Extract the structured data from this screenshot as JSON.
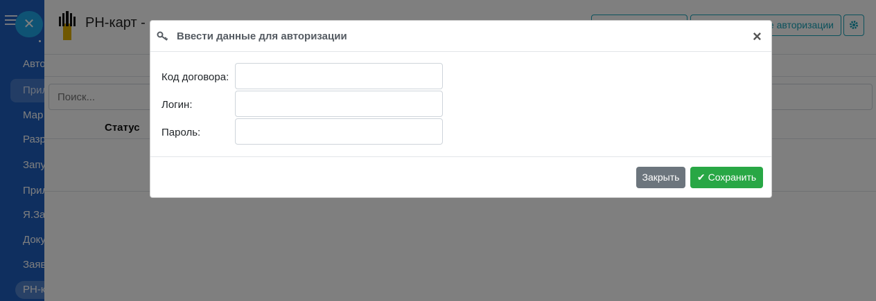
{
  "sidebar": {
    "close_icon": "✕",
    "items": [
      "Авто",
      "Прил",
      "Мар",
      "Разр",
      "Запу",
      "Прил",
      "Я.Заг",
      "Доку",
      "Заяв",
      "РН-к"
    ]
  },
  "app": {
    "title": "РН-карт -",
    "header_button_1": "",
    "header_button_2": "е авторизации",
    "settings_icon": "gear-icon"
  },
  "search": {
    "placeholder": "Поиск..."
  },
  "table": {
    "headers": [
      "Статус"
    ]
  },
  "modal": {
    "title": "Ввести данные для авторизации",
    "close_glyph": "×",
    "fields": [
      {
        "label": "Код договора:",
        "value": ""
      },
      {
        "label": "Логин:",
        "value": ""
      },
      {
        "label": "Пароль:",
        "value": ""
      }
    ],
    "close_button": "Закрыть",
    "save_button": "Сохранить"
  },
  "colors": {
    "sidebar": "#1f5fbf",
    "accent": "#17a2b8",
    "save": "#28a745",
    "close": "#6c757d"
  }
}
